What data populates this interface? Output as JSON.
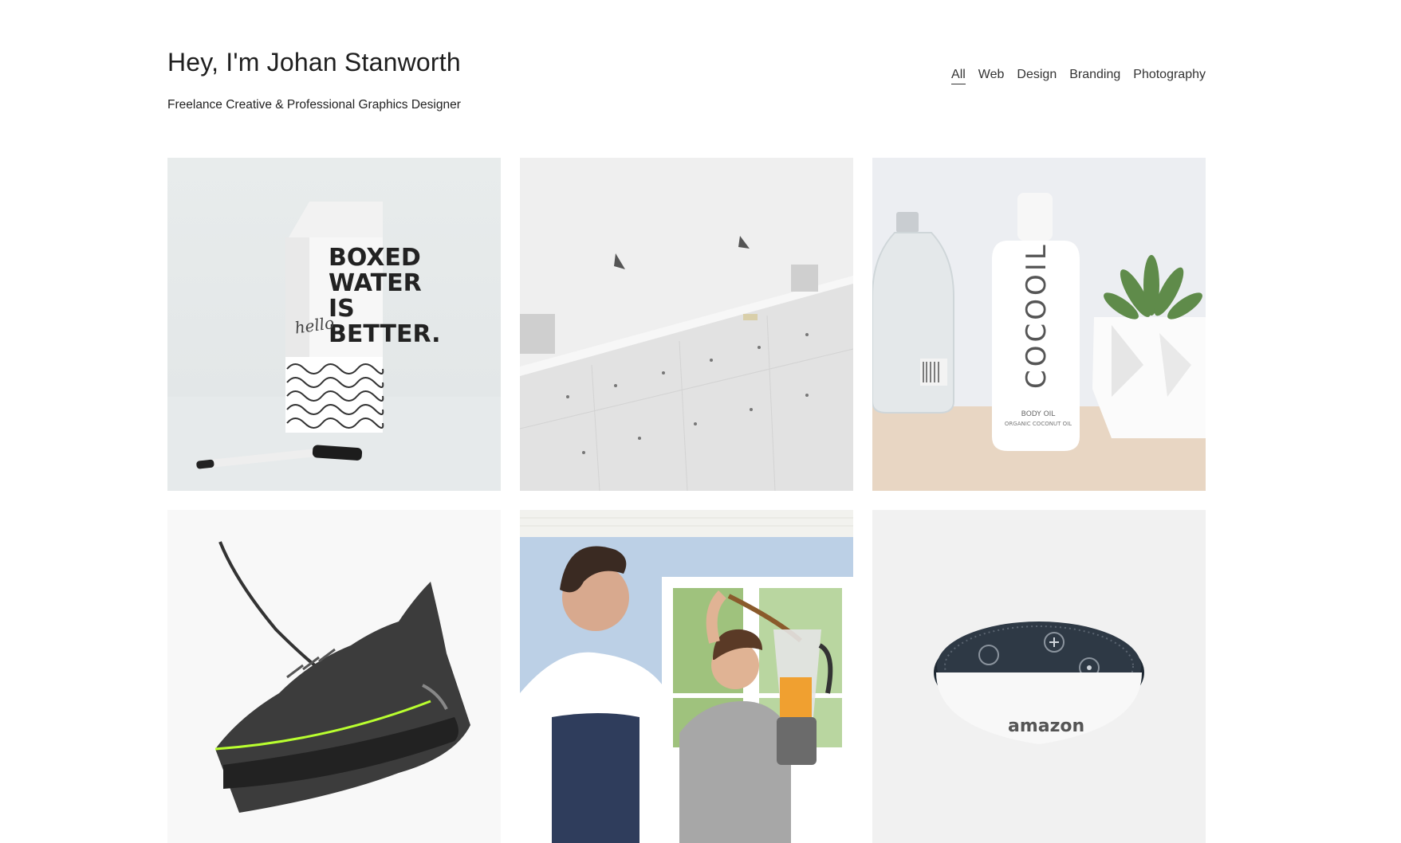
{
  "header": {
    "title": "Hey, I'm Johan Stanworth",
    "subtitle": "Freelance Creative & Professional Graphics Designer"
  },
  "nav": {
    "items": [
      {
        "label": "All",
        "active": true
      },
      {
        "label": "Web",
        "active": false
      },
      {
        "label": "Design",
        "active": false
      },
      {
        "label": "Branding",
        "active": false
      },
      {
        "label": "Photography",
        "active": false
      }
    ]
  },
  "portfolio": {
    "items": [
      {
        "subject": "boxed-water-carton",
        "carton_text": [
          "BOXED",
          "WATER",
          "IS",
          "BETTER."
        ],
        "side_text": "hello"
      },
      {
        "subject": "white-architecture-wall"
      },
      {
        "subject": "cocooil-body-oil",
        "brand": "COCOOIL",
        "line1": "BODY OIL",
        "line2": "ORGANIC COCONUT OIL"
      },
      {
        "subject": "black-sneaker"
      },
      {
        "subject": "kitchen-mother-son-blender"
      },
      {
        "subject": "amazon-echo-dot",
        "brand": "amazon"
      }
    ]
  }
}
